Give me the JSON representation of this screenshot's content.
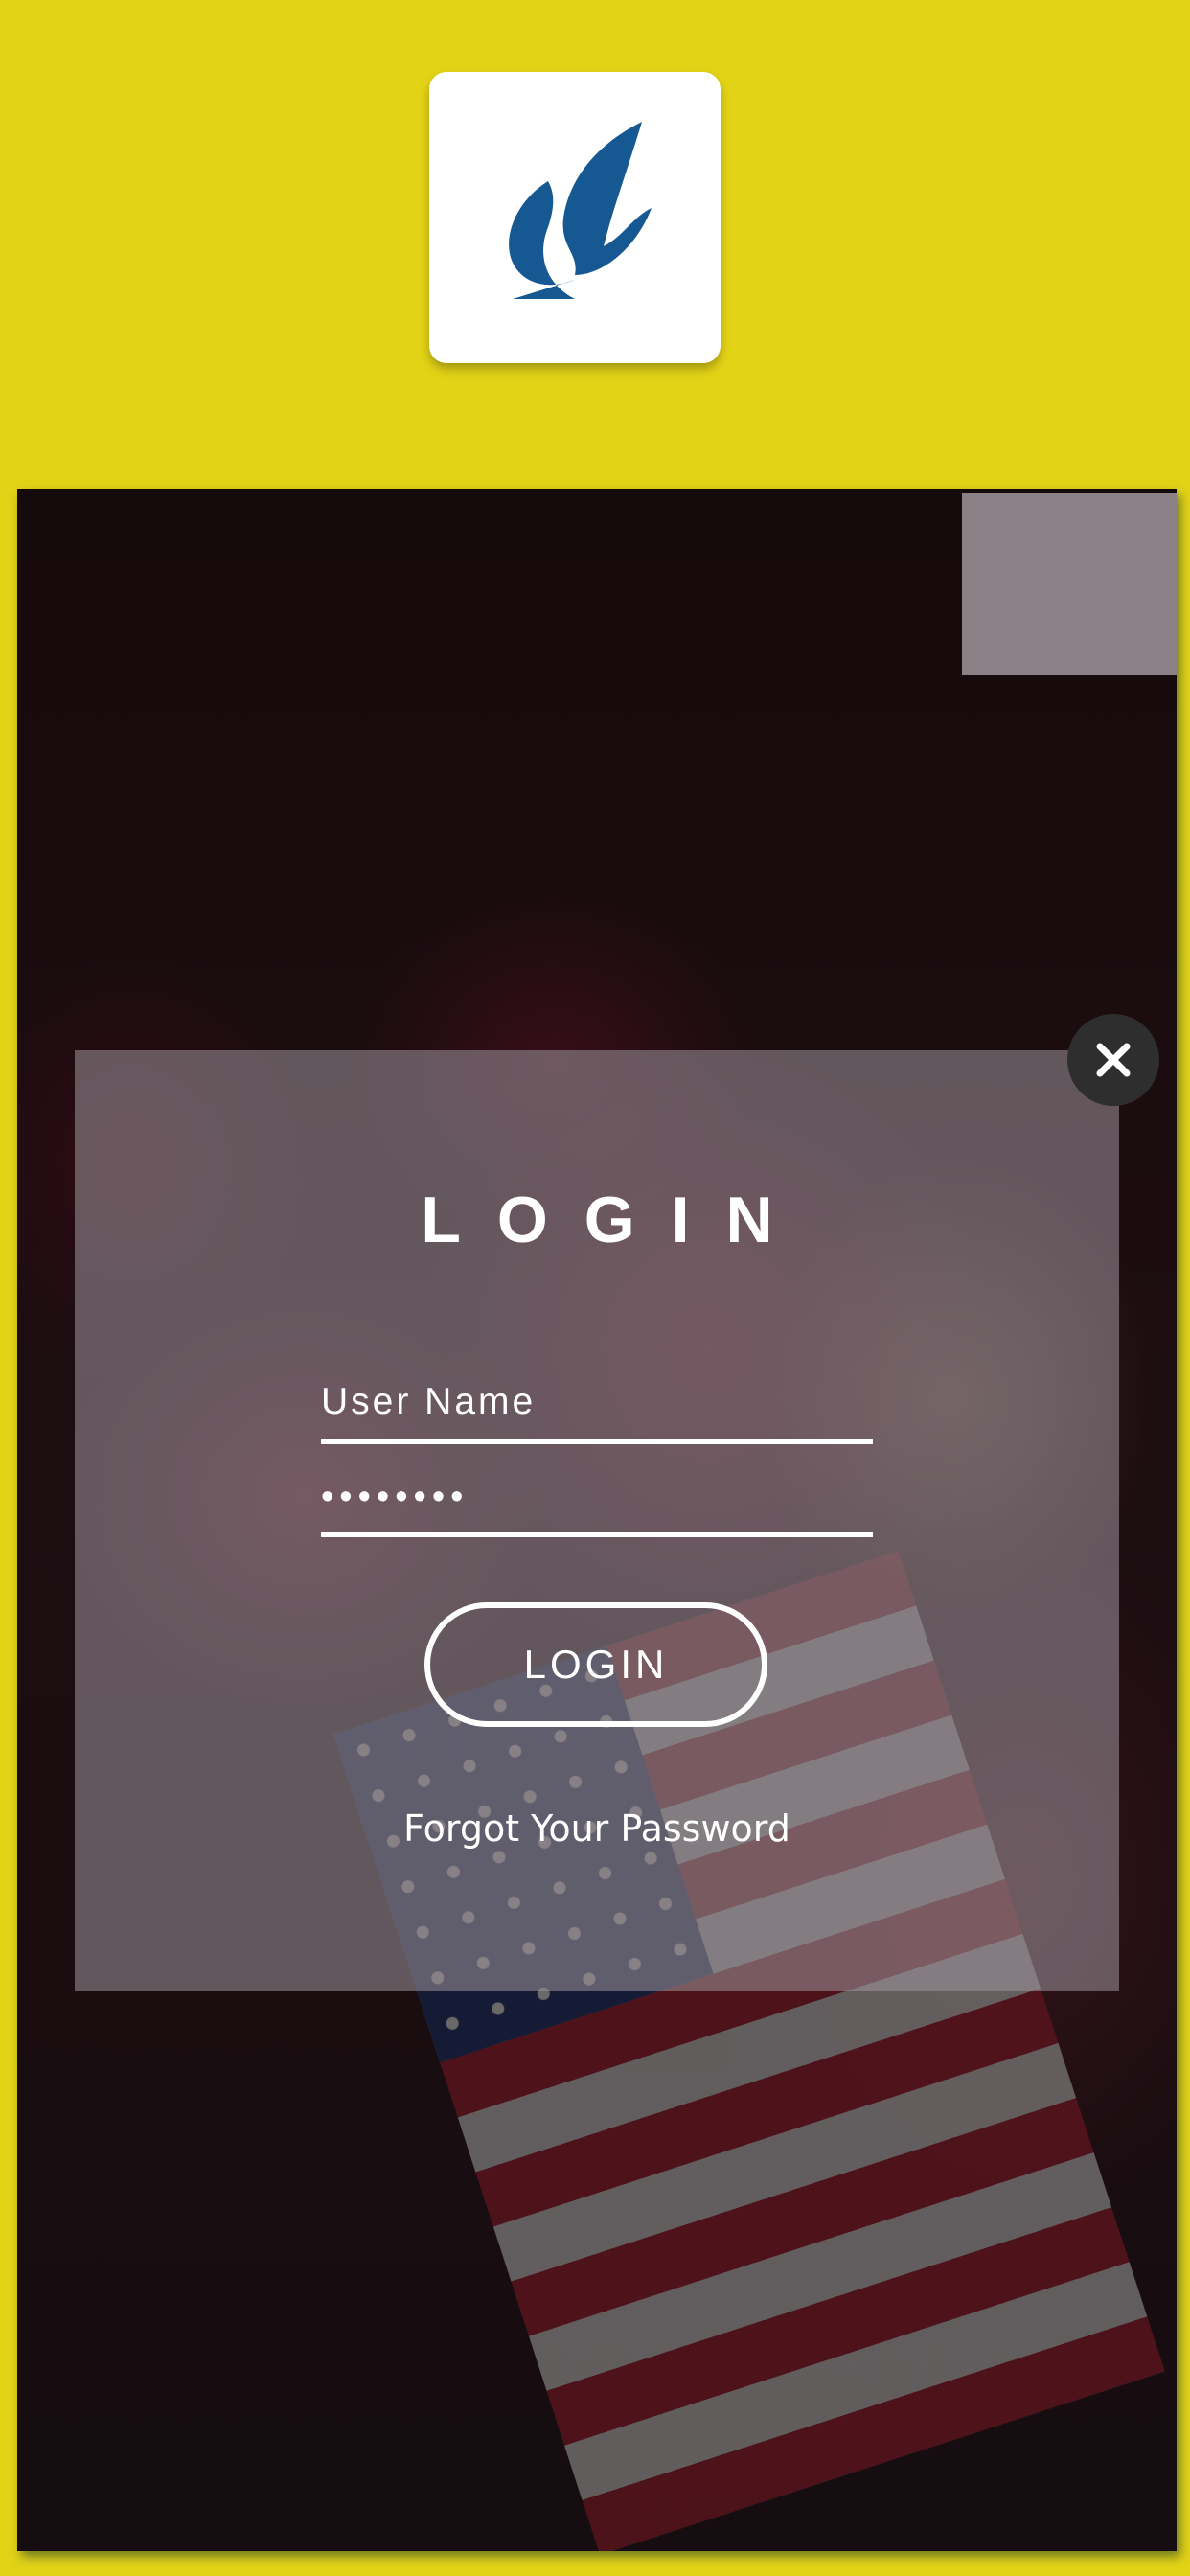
{
  "logo": {
    "name": "brand-logo",
    "color": "#165891"
  },
  "colors": {
    "background": "#e3d317",
    "modal": "#9e969c",
    "close": "#2e2e2e"
  },
  "modal": {
    "title": "LOGIN",
    "username": {
      "placeholder": "User Name",
      "value": ""
    },
    "password": {
      "value": "••••••••"
    },
    "login_button": "LOGIN",
    "forgot_link": "Forgot Your Password"
  },
  "icons": {
    "close": "close-icon"
  }
}
